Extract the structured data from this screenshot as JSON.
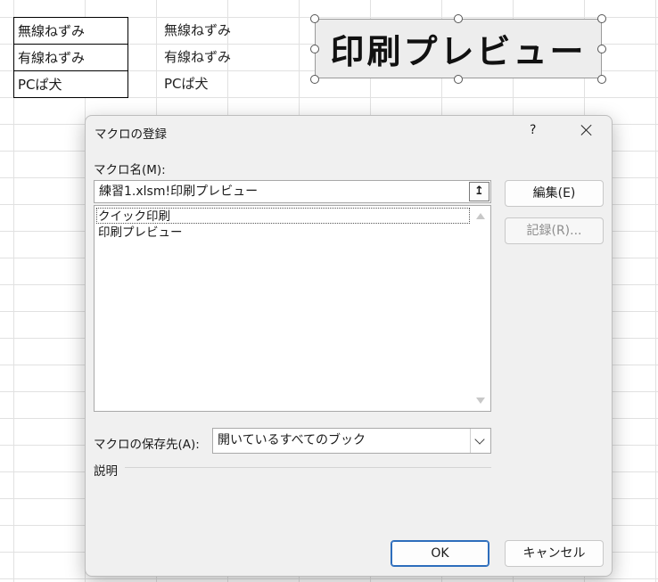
{
  "sheet": {
    "table_cells": [
      "無線ねずみ",
      "有線ねずみ",
      "PCぱ犬"
    ],
    "column_c_cells": [
      "無線ねずみ",
      "有線ねずみ",
      "PCぱ犬"
    ],
    "shape_label": "印刷プレビュー"
  },
  "dialog": {
    "title": "マクロの登録",
    "help_label": "?",
    "macro_name_label": "マクロ名(M):",
    "macro_name_value": "練習1.xlsm!印刷プレビュー",
    "collapse_icon": "↥",
    "macro_list": [
      "クイック印刷",
      "印刷プレビュー"
    ],
    "edit_button": "編集(E)",
    "record_button": "記録(R)...",
    "store_label": "マクロの保存先(A):",
    "store_value": "開いているすべてのブック",
    "description_label": "説明",
    "ok_button": "OK",
    "cancel_button": "キャンセル"
  }
}
